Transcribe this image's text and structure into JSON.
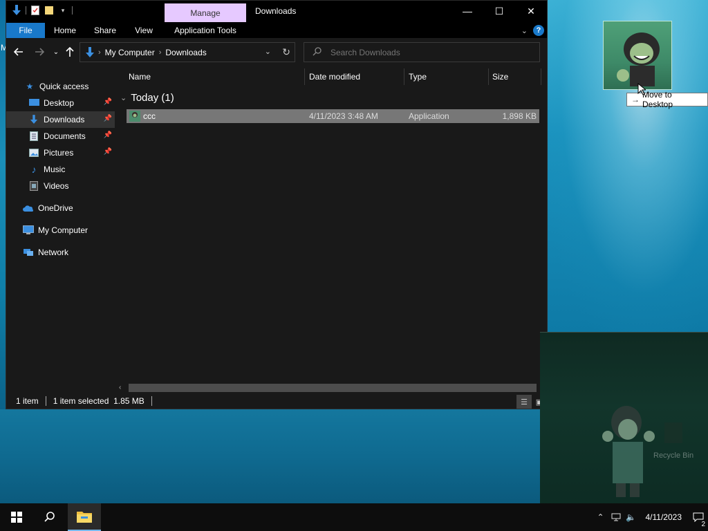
{
  "window": {
    "title": "Downloads",
    "manage_tab": "Manage",
    "minimize": "—",
    "maximize": "☐",
    "close": "✕"
  },
  "ribbon": {
    "tabs": [
      "File",
      "Home",
      "Share",
      "View",
      "Application Tools"
    ]
  },
  "address": {
    "crumbs": [
      "My Computer",
      "Downloads"
    ]
  },
  "search": {
    "placeholder": "Search Downloads"
  },
  "navpane": {
    "items": [
      {
        "label": "Quick access",
        "icon": "star-icon",
        "pinned": false
      },
      {
        "label": "Desktop",
        "icon": "desktop-icon",
        "pinned": true
      },
      {
        "label": "Downloads",
        "icon": "download-icon",
        "pinned": true,
        "selected": true
      },
      {
        "label": "Documents",
        "icon": "documents-icon",
        "pinned": true
      },
      {
        "label": "Pictures",
        "icon": "pictures-icon",
        "pinned": true
      },
      {
        "label": "Music",
        "icon": "music-icon",
        "pinned": false
      },
      {
        "label": "Videos",
        "icon": "videos-icon",
        "pinned": false
      },
      {
        "label": "OneDrive",
        "icon": "onedrive-icon",
        "pinned": false
      },
      {
        "label": "My Computer",
        "icon": "computer-icon",
        "pinned": false
      },
      {
        "label": "Network",
        "icon": "network-icon",
        "pinned": false
      }
    ]
  },
  "columns": [
    "Name",
    "Date modified",
    "Type",
    "Size"
  ],
  "group": {
    "label": "Today (1)"
  },
  "files": [
    {
      "name": "ccc",
      "date": "4/11/2023 3:48 AM",
      "type": "Application",
      "size": "1,898 KB"
    }
  ],
  "status": {
    "count": "1 item",
    "selection": "1 item selected  1.85 MB"
  },
  "drag": {
    "tooltip": "Move to Desktop"
  },
  "desktop": {
    "edge_letter": "M",
    "recycle_bin_label": "Recycle Bin"
  },
  "taskbar": {
    "clock": "4/11/2023",
    "notifications": "2"
  },
  "colors": {
    "accent": "#1979ca",
    "manage_tab": "#e6c9ff",
    "selected_row": "#777777",
    "window_bg": "#191919"
  }
}
